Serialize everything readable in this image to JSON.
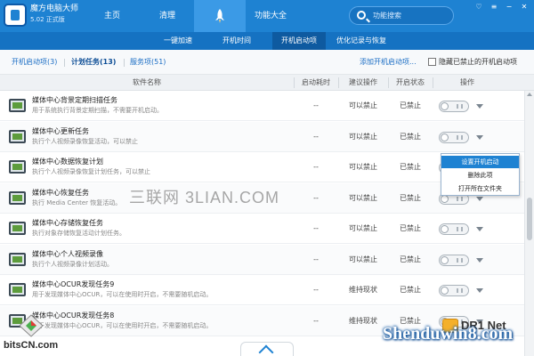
{
  "app": {
    "name": "魔方电脑大师",
    "version": "5.02 正式版"
  },
  "nav": {
    "home": "主页",
    "clean": "清理",
    "tools": "功能大全"
  },
  "search": {
    "placeholder": "功能搜索"
  },
  "window": {
    "skin": "♡",
    "menu": "≡",
    "minimize": "−",
    "close": "✕"
  },
  "subtabs": [
    "一键加速",
    "开机时间",
    "开机启动项",
    "优化记录与恢复"
  ],
  "filter": {
    "tabs": [
      "开机启动项(3)",
      "计划任务(13)",
      "服务项(51)"
    ],
    "add_link": "添加开机启动项...",
    "hide_label": "隐藏已禁止的开机启动项"
  },
  "table": {
    "headers": [
      "软件名称",
      "启动耗时",
      "建议操作",
      "开启状态",
      "操作"
    ],
    "rows": [
      {
        "name": "媒体中心背景定期扫描任务",
        "desc": "用于系统执行背景定期扫描，不需要开机启动。",
        "time": "--",
        "advice": "可以禁止",
        "status": "已禁止"
      },
      {
        "name": "媒体中心更新任务",
        "desc": "执行个人视频录像恢复活动，可以禁止",
        "time": "--",
        "advice": "可以禁止",
        "status": "已禁止"
      },
      {
        "name": "媒体中心数据恢复计划",
        "desc": "执行个人视频录像恢复计划任务，可以禁止",
        "time": "--",
        "advice": "可以禁止",
        "status": "已禁止"
      },
      {
        "name": "媒体中心恢复任务",
        "desc": "执行 Media Center 恢复活动。",
        "time": "--",
        "advice": "可以禁止",
        "status": "已禁止"
      },
      {
        "name": "媒体中心存储恢复任务",
        "desc": "执行对象存储恢复活动计划任务。",
        "time": "--",
        "advice": "可以禁止",
        "status": "已禁止"
      },
      {
        "name": "媒体中心个人视频录像",
        "desc": "执行个人视频录像计划活动。",
        "time": "--",
        "advice": "可以禁止",
        "status": "已禁止"
      },
      {
        "name": "媒体中心OCUR发现任务9",
        "desc": "用于发现媒体中心OCUR，可以在使用时开启，不需要随机启动。",
        "time": "--",
        "advice": "维持现状",
        "status": "已禁止"
      },
      {
        "name": "媒体中心OCUR发现任务8",
        "desc": "用于发现媒体中心OCUR，可以在使用时开启，不需要随机启动。",
        "time": "--",
        "advice": "维持现状",
        "status": "已禁止"
      }
    ]
  },
  "context_menu": {
    "items": [
      "设置开机启动",
      "删除此项",
      "打开所在文件夹"
    ]
  },
  "watermarks": {
    "center": "三联网 3LIAN.COM",
    "bits": "bitsCN.com",
    "shendu": "Shenduwin8.com",
    "fragment": "DR1 Net"
  },
  "colors": {
    "header": "#1e82d2",
    "subbar": "#1572c2",
    "accent": "#1e82d2"
  }
}
